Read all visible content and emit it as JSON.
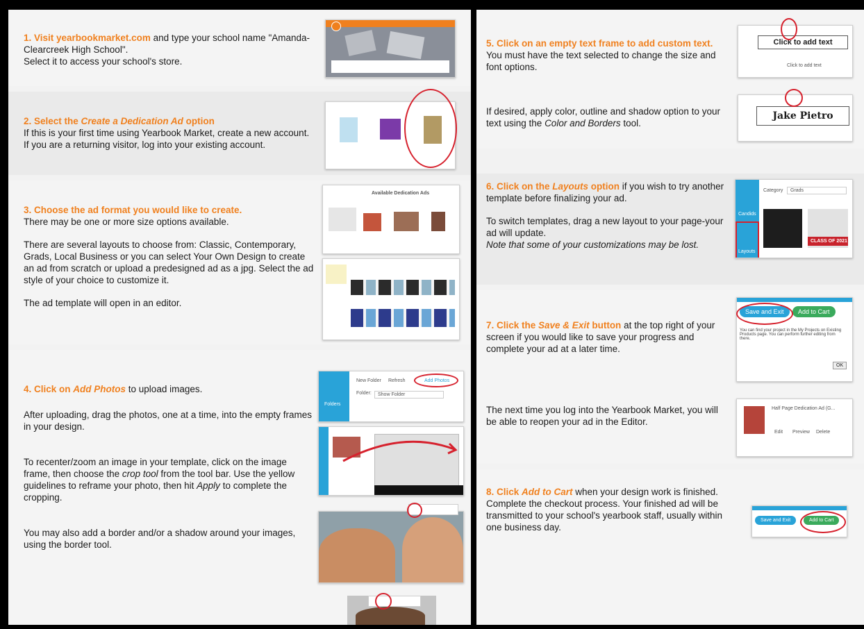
{
  "left": {
    "step1": {
      "heading": "1. Visit yearbookmarket.com",
      "body": " and type your school name \"Amanda-Clearcreek High School\".",
      "body2": "Select it to access your school's store."
    },
    "step2": {
      "heading_a": "2. Select the ",
      "heading_b": "Create a Dedication Ad",
      "heading_c": " option",
      "body": "If this is your first time using Yearbook Market, create a new account.  If you are a returning visitor, log into your existing account."
    },
    "step3": {
      "heading": "3. Choose the ad format you would like to create.",
      "body": "There may be one or more size options available.",
      "p2": "There are several layouts to choose from: Classic, Contemporary, Grads, Local Business or you can select Your Own Design to create an ad from scratch or upload a predesigned ad as a jpg. Select the ad style of your choice to customize it.",
      "p3": "The ad template will open in an editor.",
      "shot_title": "Available Dedication Ads"
    },
    "step4": {
      "heading_a": "4. Click on ",
      "heading_b": "Add Photos",
      "body": " to upload images.",
      "p2": "After uploading, drag the photos, one at a time, into the empty frames in your design.",
      "p3_a": "To recenter/zoom an image in your template, click on the image frame, then choose the ",
      "p3_b": "crop tool",
      "p3_c": " from the tool bar.  Use the yellow guidelines to reframe your photo, then hit ",
      "p3_d": "Apply",
      "p3_e": " to complete the cropping.",
      "p4": "You may also add a border and/or a shadow around your images, using the border tool.",
      "shot_folder": "Folder:",
      "shot_folder_val": "Show Folder",
      "shot_new_folder": "New Folder",
      "shot_refresh": "Refresh",
      "shot_add_photos": "Add Photos",
      "shot_folders_tab": "Folders"
    }
  },
  "right": {
    "step5": {
      "heading": "5. Click on an empty text frame to add custom text.",
      "body": " You must have the text selected to change the size and font options.",
      "p2_a": "If desired, apply color, outline and shadow option to your text using the ",
      "p2_b": "Color and Borders",
      "p2_c": " tool.",
      "shot1_text": "Click to add text",
      "shot1_sub": "Click to add text",
      "shot2_text": "Jake Pietro"
    },
    "step6": {
      "heading_a": "6. Click on the ",
      "heading_b": "Layouts",
      "heading_c": " option",
      "body": " if you wish to try another template before finalizing your ad.",
      "p2": "To switch templates, drag a new layout to your page-your ad will update.",
      "p3": "Note that some of your customizations may be lost.",
      "shot_category": "Category",
      "shot_category_val": "Grads",
      "shot_tab1": "Candids",
      "shot_tab2": "Layouts",
      "shot_banner": "CLASS OF 2021"
    },
    "step7": {
      "heading_a": "7. Click the ",
      "heading_b": "Save & Exit",
      "heading_c": " button",
      "body": " at the top right of your screen if you would like to save your progress and complete your ad at a later time.",
      "p2": "The next time you log into the Yearbook Market, you will be able to reopen your ad in the Editor.",
      "shot_save": "Save and Exit",
      "shot_cart": "Add to Cart",
      "shot_msg": "You can find your project in the My Projects on Existing Products page. You can perform further editing from there.",
      "shot_ok": "OK",
      "shot2_title": "Half Page Dedication Ad (G...",
      "shot2_edit": "Edit",
      "shot2_preview": "Preview",
      "shot2_delete": "Delete"
    },
    "step8": {
      "heading_a": "8. Click ",
      "heading_b": "Add to Cart",
      "body": "  when your design work is finished.  Complete the checkout process.  Your finished ad will be transmitted to your school's yearbook staff, usually within one business day.",
      "shot_save": "Save and Exit",
      "shot_cart": "Add to Cart"
    }
  },
  "colors": {
    "accent": "#f0801e",
    "ring": "#d6212d",
    "teal": "#29a3d8",
    "green": "#3aaa5c"
  }
}
